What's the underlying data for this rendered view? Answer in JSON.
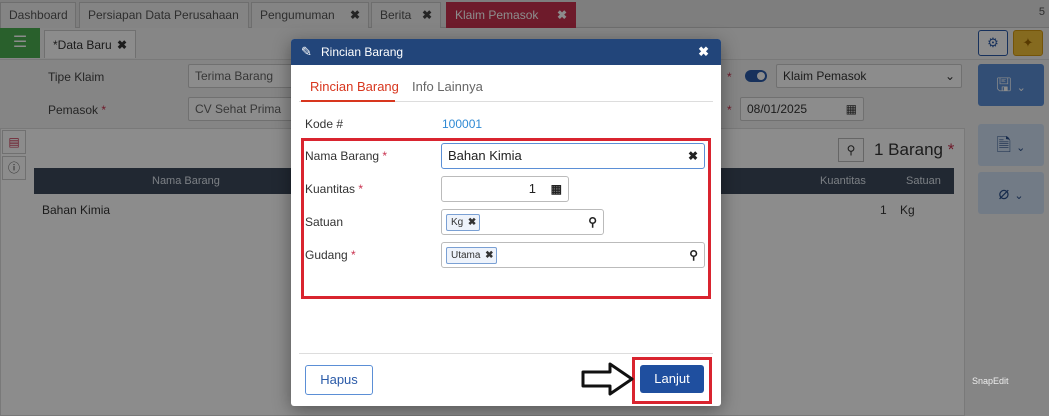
{
  "tabs": [
    {
      "label": "Dashboard",
      "closable": false
    },
    {
      "label": "Persiapan Data Perusahaan",
      "closable": false
    },
    {
      "label": "Pengumuman",
      "closable": true
    },
    {
      "label": "Berita",
      "closable": true
    },
    {
      "label": "Klaim Pemasok",
      "closable": true,
      "active": true
    }
  ],
  "tab_count": "5",
  "subtab": {
    "label": "Data Baru",
    "marker": "*"
  },
  "form": {
    "tipe_klaim_label": "Tipe Klaim",
    "tipe_klaim_value": "Terima Barang",
    "pemasok_label": "Pemasok",
    "pemasok_value": "CV Sehat Prima",
    "right_select_value": "Klaim Pemasok",
    "date_value": "08/01/2025",
    "req_mark": "*"
  },
  "grid": {
    "count_label": "1 Barang",
    "req_mark": "*",
    "columns": [
      "Nama Barang",
      "Kuantitas",
      "Satuan"
    ],
    "rows": [
      {
        "nama": "Bahan Kimia",
        "kuantitas": "1",
        "satuan": "Kg"
      }
    ]
  },
  "modal": {
    "title": "Rincian Barang",
    "tabs": [
      "Rincian Barang",
      "Info Lainnya"
    ],
    "kode_label": "Kode #",
    "kode_value": "100001",
    "nama_label": "Nama Barang",
    "nama_value": "Bahan Kimia",
    "kuantitas_label": "Kuantitas",
    "kuantitas_value": "1",
    "satuan_label": "Satuan",
    "satuan_chip": "Kg",
    "gudang_label": "Gudang",
    "gudang_chip": "Utama",
    "req_mark": "*",
    "hapus_label": "Hapus",
    "lanjut_label": "Lanjut"
  },
  "watermark": "SnapEdit",
  "colors": {
    "accent": "#c9324f",
    "primary": "#1f4f9f",
    "highlight": "#d9242f",
    "header": "#22457a"
  }
}
